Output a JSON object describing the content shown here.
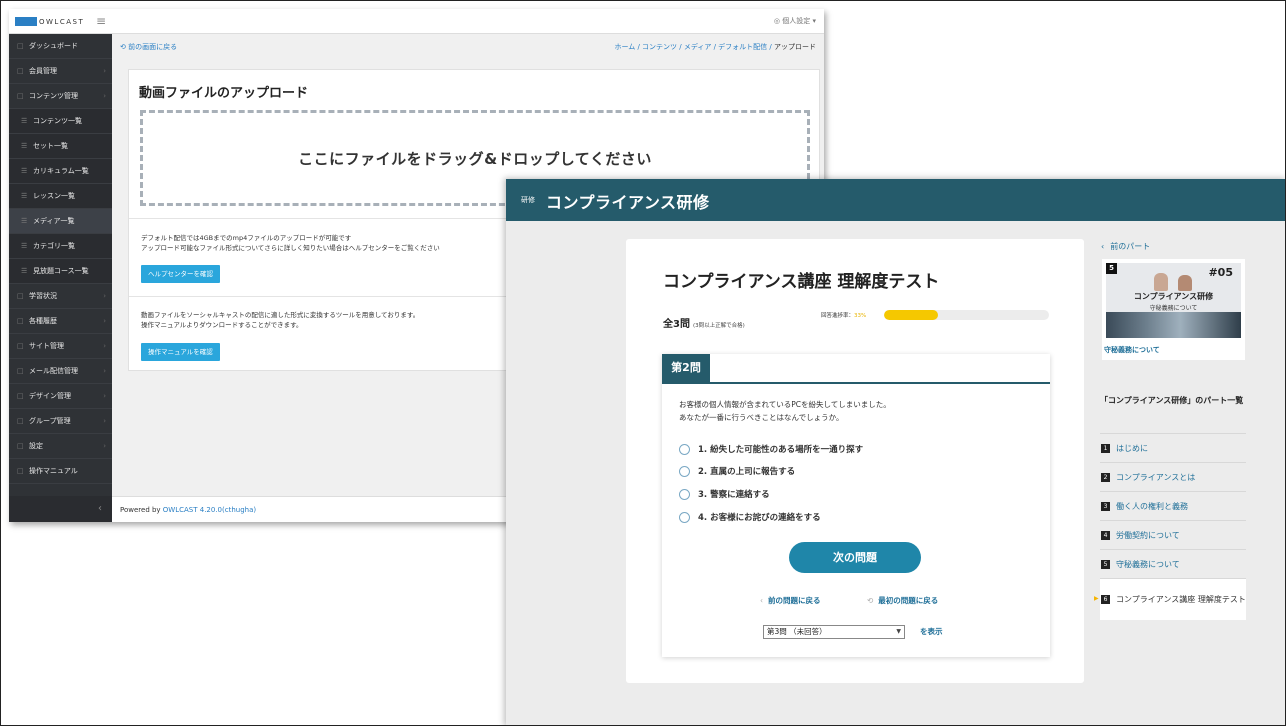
{
  "admin": {
    "logo_text": "OWLCAST",
    "user_menu": "◎ 個人設定 ▾",
    "sidebar": [
      {
        "label": "ダッシュボード",
        "sub": false,
        "arrow": false
      },
      {
        "label": "会員管理",
        "sub": false,
        "arrow": true
      },
      {
        "label": "コンテンツ管理",
        "sub": false,
        "arrow": true
      },
      {
        "label": "コンテンツ一覧",
        "sub": true,
        "arrow": false
      },
      {
        "label": "セット一覧",
        "sub": true,
        "arrow": false
      },
      {
        "label": "カリキュラム一覧",
        "sub": true,
        "arrow": false
      },
      {
        "label": "レッスン一覧",
        "sub": true,
        "arrow": false
      },
      {
        "label": "メディア一覧",
        "sub": true,
        "arrow": false,
        "active": true
      },
      {
        "label": "カテゴリ一覧",
        "sub": true,
        "arrow": false
      },
      {
        "label": "見放題コース一覧",
        "sub": true,
        "arrow": false
      },
      {
        "label": "学習状況",
        "sub": false,
        "arrow": true
      },
      {
        "label": "各種履歴",
        "sub": false,
        "arrow": true
      },
      {
        "label": "サイト管理",
        "sub": false,
        "arrow": true
      },
      {
        "label": "メール配信管理",
        "sub": false,
        "arrow": true
      },
      {
        "label": "デザイン管理",
        "sub": false,
        "arrow": true
      },
      {
        "label": "グループ管理",
        "sub": false,
        "arrow": true
      },
      {
        "label": "設定",
        "sub": false,
        "arrow": true
      },
      {
        "label": "操作マニュアル",
        "sub": false,
        "arrow": false
      }
    ],
    "back_link": "前の画面に戻る",
    "breadcrumb": {
      "links": "ホーム / コンテンツ / メディア / デフォルト配信 / ",
      "current": "アップロード"
    },
    "upload_title": "動画ファイルのアップロード",
    "dropzone_text": "ここにファイルをドラッグ&ドロップしてください",
    "info1_line1": "デフォルト配信では4GBまでのmp4ファイルのアップロードが可能です",
    "info1_line2": "アップロード可能なファイル形式についてさらに詳しく知りたい場合はヘルプセンターをご覧ください",
    "help_button": "ヘルプセンターを確認",
    "info2_line1": "動画ファイルをソーシャルキャストの配信に適した形式に変換するツールを用意しております。",
    "info2_line2": "操作マニュアルよりダウンロードすることができます。",
    "manual_button": "操作マニュアルを確認",
    "footer_prefix": "Powered by ",
    "footer_version": "OWLCAST 4.20.0(cthugha)"
  },
  "quiz": {
    "tag": "研修",
    "course_title": "コンプライアンス研修",
    "test_title": "コンプライアンス講座 理解度テスト",
    "total": "全3問",
    "total_note": "(3問以上正解で合格)",
    "rate_label": "回答進捗率：",
    "rate_value": "33%",
    "progress": 0.33,
    "question_number": "第2問",
    "question_line1": "お客様の個人情報が含まれているPCを紛失してしまいました。",
    "question_line2": "あなたが一番に行うべきことはなんでしょうか。",
    "choices": [
      "1. 紛失した可能性のある場所を一通り探す",
      "2. 直属の上司に報告する",
      "3. 警察に連絡する",
      "4. お客様にお詫びの連絡をする"
    ],
    "next_button": "次の問題",
    "prev_question": "前の問題に戻る",
    "first_question": "最初の問題に戻る",
    "select_value": "第3問 （未回答）",
    "show_link": "を表示",
    "prev_part": "前のパート",
    "part_card": {
      "num": "5",
      "code": "#05",
      "title": "コンプライアンス研修",
      "subtitle": "守秘義務について",
      "link": "守秘義務について"
    },
    "list_title": "「コンプライアンス研修」のパート一覧",
    "parts": [
      {
        "num": "1",
        "label": "はじめに"
      },
      {
        "num": "2",
        "label": "コンプライアンスとは"
      },
      {
        "num": "3",
        "label": "働く人の権利と義務"
      },
      {
        "num": "4",
        "label": "労働契約について"
      },
      {
        "num": "5",
        "label": "守秘義務について"
      },
      {
        "num": "6",
        "label": "コンプライアンス講座 理解度テスト",
        "current": true
      }
    ]
  }
}
